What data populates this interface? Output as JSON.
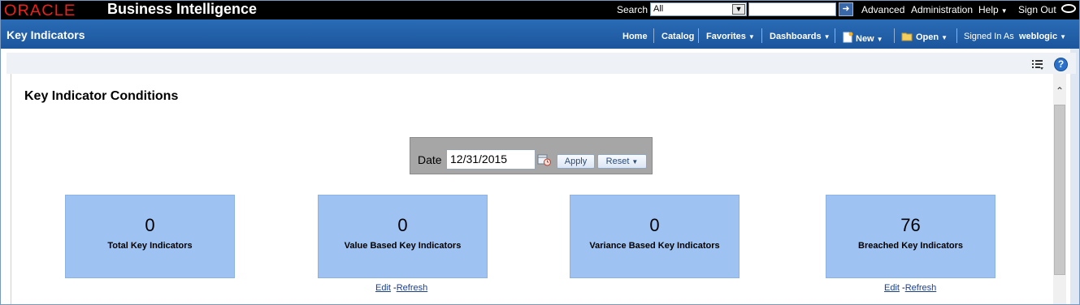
{
  "topbar": {
    "logo_text": "ORACLE",
    "product_name": "Business Intelligence",
    "search_label": "Search",
    "search_scope": "All",
    "search_query": "",
    "links": {
      "advanced": "Advanced",
      "administration": "Administration",
      "help": "Help",
      "sign_out": "Sign Out"
    }
  },
  "header": {
    "title": "Key Indicators",
    "nav": {
      "home": "Home",
      "catalog": "Catalog",
      "favorites": "Favorites",
      "dashboards": "Dashboards",
      "new": "New",
      "open": "Open",
      "signed_in_as": "Signed In As",
      "username": "weblogic"
    }
  },
  "main": {
    "section_title": "Key Indicator Conditions",
    "prompt": {
      "label": "Date",
      "value": "12/31/2015",
      "apply_label": "Apply",
      "reset_label": "Reset"
    },
    "tiles": [
      {
        "value": "0",
        "label": "Total Key Indicators"
      },
      {
        "value": "0",
        "label": "Value Based Key Indicators"
      },
      {
        "value": "0",
        "label": "Variance Based Key Indicators"
      },
      {
        "value": "76",
        "label": "Breached Key Indicators"
      }
    ],
    "links": {
      "edit": "Edit",
      "dash": "-",
      "refresh": "Refresh"
    }
  },
  "icons": {
    "search_go": "arrow-right-icon",
    "new": "new-document-icon",
    "open": "folder-icon",
    "page_options": "list-options-icon",
    "help": "help-icon",
    "calendar": "calendar-icon"
  },
  "colors": {
    "topbar": "#000000",
    "header": "#1f5fa8",
    "oracle_red": "#e8221b",
    "tile_fill": "#9ec3f3",
    "prompt_bg": "#a6a6a6"
  }
}
